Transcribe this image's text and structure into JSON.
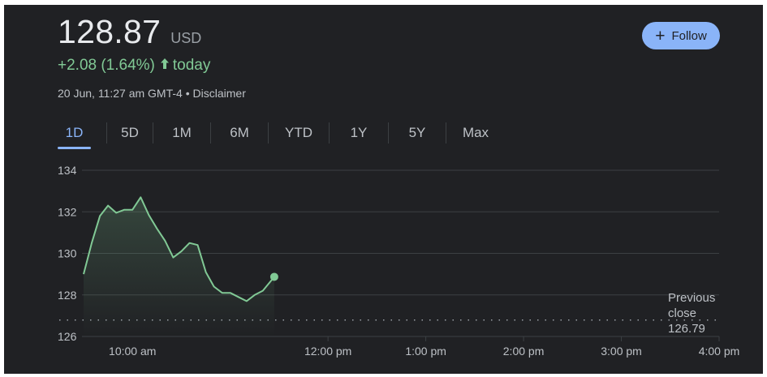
{
  "quote": {
    "price": "128.87",
    "currency": "USD",
    "change": "+2.08 (1.64%)",
    "change_suffix": "today",
    "timestamp": "20 Jun, 11:27 am GMT-4",
    "separator": "•",
    "disclaimer": "Disclaimer"
  },
  "follow_button": {
    "icon": "plus-icon",
    "label": "Follow"
  },
  "tabs": [
    {
      "label": "1D",
      "active": true
    },
    {
      "label": "5D",
      "active": false
    },
    {
      "label": "1M",
      "active": false
    },
    {
      "label": "6M",
      "active": false
    },
    {
      "label": "YTD",
      "active": false
    },
    {
      "label": "1Y",
      "active": false
    },
    {
      "label": "5Y",
      "active": false
    },
    {
      "label": "Max",
      "active": false
    }
  ],
  "previous_close": {
    "line1": "Previous",
    "line2": "close",
    "value": "126.79"
  },
  "colors": {
    "background": "#202124",
    "up": "#81c995",
    "accent": "#8ab4f8",
    "grid": "#3c4043",
    "text": "#bdc1c6"
  },
  "chart_data": {
    "type": "area",
    "xlabel": "",
    "ylabel": "",
    "grid": true,
    "ylim": [
      126,
      134
    ],
    "yticks": [
      134,
      132,
      130,
      128,
      126
    ],
    "xlim": [
      "09:30",
      "16:00"
    ],
    "xticks": [
      {
        "time": "10:00",
        "label": "10:00 am"
      },
      {
        "time": "12:00",
        "label": "12:00 pm"
      },
      {
        "time": "13:00",
        "label": "1:00 pm"
      },
      {
        "time": "14:00",
        "label": "2:00 pm"
      },
      {
        "time": "15:00",
        "label": "3:00 pm"
      },
      {
        "time": "16:00",
        "label": "4:00 pm"
      }
    ],
    "previous_close": 126.79,
    "series": [
      {
        "x": [
          "09:30",
          "09:35",
          "09:40",
          "09:45",
          "09:50",
          "09:55",
          "10:00",
          "10:05",
          "10:10",
          "10:15",
          "10:20",
          "10:25",
          "10:30",
          "10:35",
          "10:40",
          "10:45",
          "10:50",
          "10:55",
          "11:00",
          "11:05",
          "11:10",
          "11:15",
          "11:20",
          "11:27"
        ],
        "values": [
          129.0,
          130.5,
          131.8,
          132.3,
          131.95,
          132.1,
          132.1,
          132.7,
          131.85,
          131.2,
          130.6,
          129.8,
          130.1,
          130.5,
          130.4,
          129.1,
          128.4,
          128.1,
          128.1,
          127.9,
          127.7,
          128.0,
          128.2,
          128.87
        ]
      }
    ]
  }
}
